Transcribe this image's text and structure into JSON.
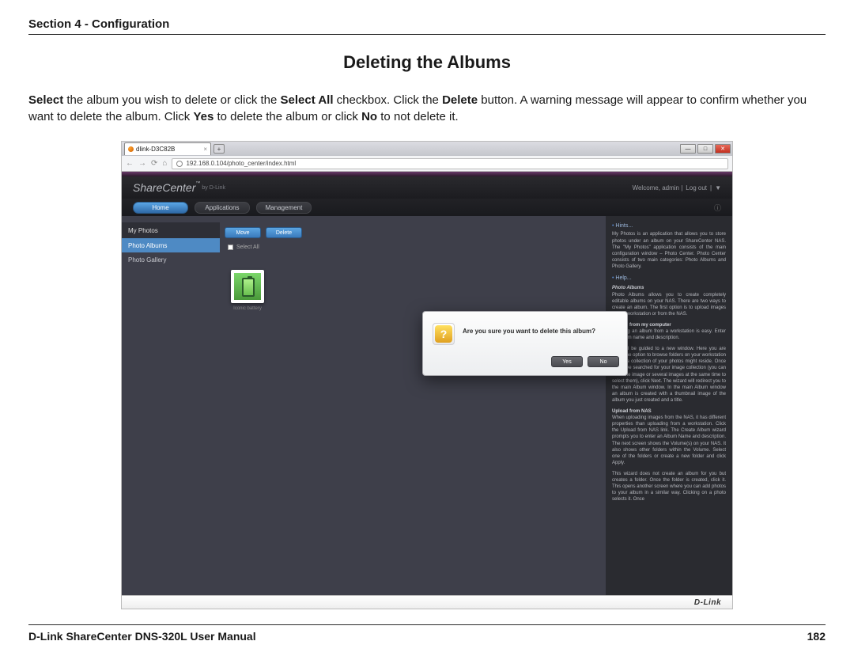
{
  "doc": {
    "section_header": "Section 4 - Configuration",
    "page_title": "Deleting the Albums",
    "paragraph_parts": {
      "p1a": "Select",
      "p1b": " the album you wish to delete or click the ",
      "p1c": "Select All",
      "p1d": " checkbox. Click the ",
      "p1e": "Delete",
      "p1f": " button. A warning message will appear to confirm whether you want to delete the album. Click ",
      "p1g": "Yes",
      "p1h": " to delete the album or click ",
      "p1i": "No",
      "p1j": " to not delete it."
    },
    "footer_left": "D-Link ShareCenter DNS-320L User Manual",
    "footer_right": "182"
  },
  "browser": {
    "tab_title": "dlink-D3C82B",
    "url": "192.168.0.104/photo_center/index.html"
  },
  "app": {
    "brand": "ShareCenter",
    "brand_sub": "by D-Link",
    "welcome_prefix": "Welcome, admin |",
    "logout": "Log out",
    "nav": {
      "home": "Home",
      "applications": "Applications",
      "management": "Management"
    },
    "sidebar": {
      "header": "My Photos",
      "item_albums": "Photo Albums",
      "item_gallery": "Photo Gallery"
    },
    "toolbar": {
      "move": "Move",
      "delete": "Delete",
      "select_all": "Select All"
    },
    "album": {
      "name": "Iconic battery"
    },
    "dialog": {
      "message": "Are you sure you want to delete this album?",
      "yes": "Yes",
      "no": "No"
    },
    "right_panel": {
      "hints_title": "Hints...",
      "hints_body": "My Photos is an application that allows you to store photos under an album on your ShareCenter NAS. The \"My Photos\" application consists of the main configuration window – Photo Center. Photo Center consists of two main categories: Photo Albums and Photo Gallery.",
      "help_title": "Help...",
      "help_sub1": "Photo Albums",
      "help_body1": "Photo Albums allows you to create completely editable albums on your NAS. There are two ways to create an album. The first option is to upload images from a workstation or from the NAS.",
      "help_sub2": "Upload from my computer",
      "help_body2": "Creating an album from a workstation is easy. Enter an album name and description.",
      "help_body3": "You will be guided to a new window. Here you are given the option to browse folders on your workstation where a collection of your photos might reside. Once you have searched for your image collection (you can click one image or several images at the same time to select them), click Next. The wizard will redirect you to the main Album window. In the main Album window an album is created with a thumbnail image of the album you just created and a title.",
      "help_sub3": "Upload from NAS",
      "help_body4": "When uploading images from the NAS, it has different properties than uploading from a workstation. Click the Upload from NAS link. The Create Album wizard prompts you to enter an Album Name and description. The next screen shows the Volume(s) on your NAS. It also shows other folders within the Volume. Select one of the folders or create a new folder and click Apply.",
      "help_body5": "This wizard does not create an album for you but creates a folder. Once the folder is created, click it. This opens another screen where you can add photos to your album in a similar way. Clicking on a photo selects it. Once"
    },
    "footer_brand": "D-Link"
  }
}
